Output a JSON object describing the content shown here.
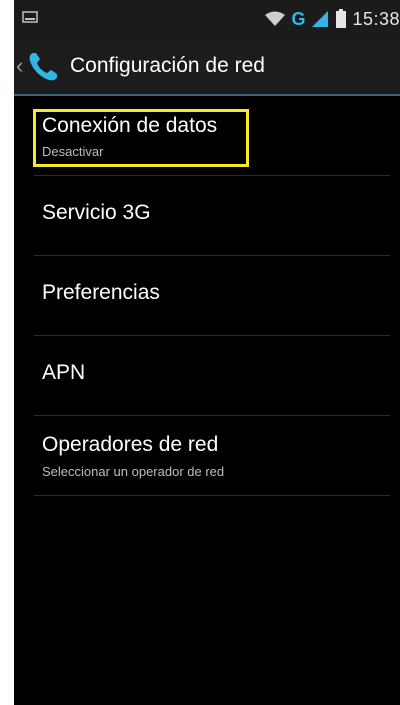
{
  "status_bar": {
    "network": "G",
    "time": "15:38",
    "icons": [
      "notification-icon",
      "wifi-icon",
      "signal-icon",
      "battery-icon"
    ]
  },
  "action_bar": {
    "back_glyph": "‹",
    "title": "Configuración de red",
    "icon": "phone-icon"
  },
  "settings": {
    "items": [
      {
        "title": "Conexión de datos",
        "summary": "Desactivar",
        "highlighted": true
      },
      {
        "title": "Servicio 3G"
      },
      {
        "title": "Preferencias"
      },
      {
        "title": "APN"
      },
      {
        "title": "Operadores de red",
        "summary": "Seleccionar un operador de red"
      }
    ]
  },
  "colors": {
    "accent": "#33b5e5",
    "highlight": "#f5e92a"
  }
}
